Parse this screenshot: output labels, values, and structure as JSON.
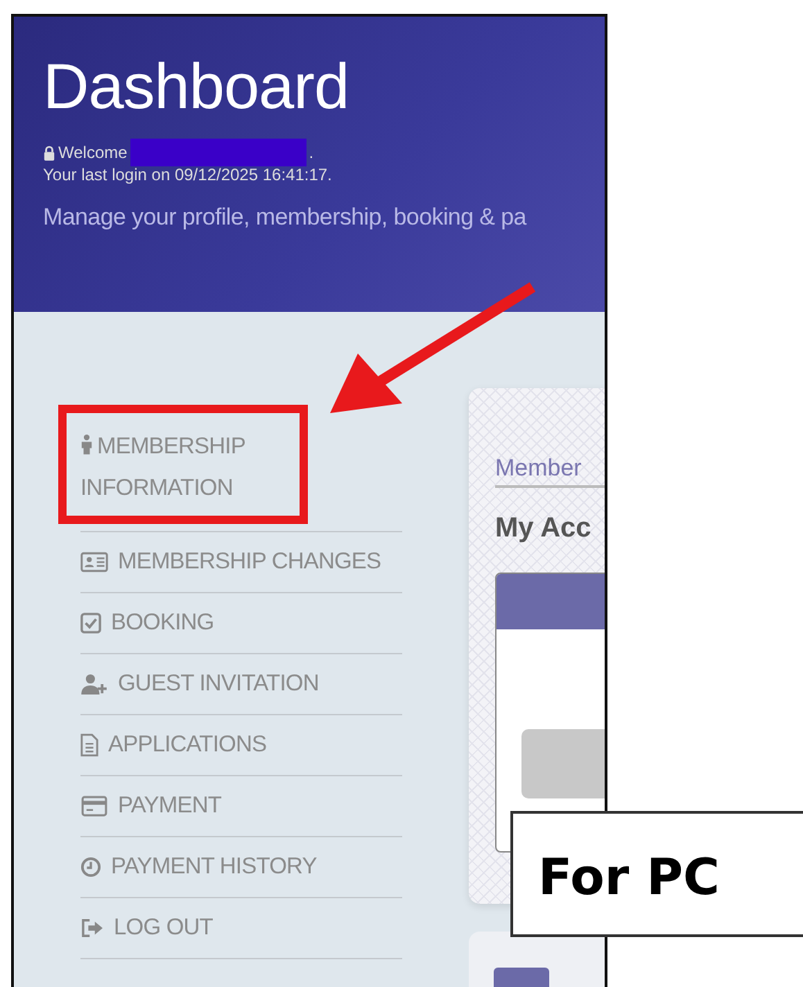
{
  "header": {
    "title": "Dashboard",
    "welcome_prefix": "Welcome",
    "welcome_suffix": ".",
    "last_login": "Your last login on 09/12/2025 16:41:17.",
    "subtitle": "Manage your profile, membership, booking & pa"
  },
  "sidebar": {
    "items": [
      {
        "label": "MEMBERSHIP INFORMATION"
      },
      {
        "label": "MEMBERSHIP CHANGES"
      },
      {
        "label": "BOOKING"
      },
      {
        "label": "GUEST INVITATION"
      },
      {
        "label": "APPLICATIONS"
      },
      {
        "label": "PAYMENT"
      },
      {
        "label": "PAYMENT HISTORY"
      },
      {
        "label": "LOG OUT"
      }
    ]
  },
  "card": {
    "link": "Member",
    "heading": "My Acc"
  },
  "annotation": {
    "label": "For PC"
  }
}
